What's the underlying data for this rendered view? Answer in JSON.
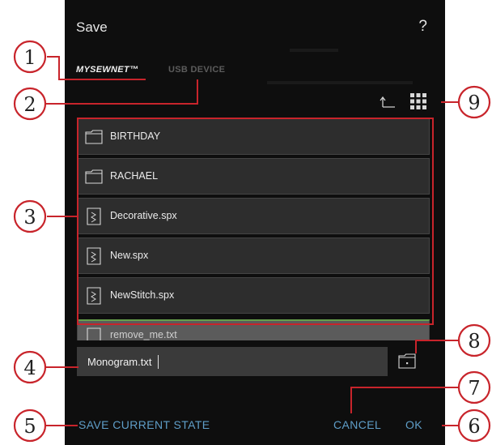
{
  "dialog": {
    "title": "Save",
    "help_label": "?",
    "tabs": [
      {
        "label": "MYSEWNET™",
        "active": true
      },
      {
        "label": "USB DEVICE",
        "active": false
      }
    ],
    "toolbar": {
      "up_icon": "folder-up-icon",
      "view_icon": "grid-view-icon"
    },
    "files": [
      {
        "name": "BIRTHDAY",
        "type": "folder",
        "icon": "folder-icon"
      },
      {
        "name": "RACHAEL",
        "type": "folder",
        "icon": "folder-icon"
      },
      {
        "name": "Decorative.spx",
        "type": "file",
        "icon": "stitch-file-icon"
      },
      {
        "name": "New.spx",
        "type": "file",
        "icon": "stitch-file-icon"
      },
      {
        "name": "NewStitch.spx",
        "type": "file",
        "icon": "stitch-file-icon"
      },
      {
        "name": "remove_me.txt",
        "type": "file",
        "icon": "stitch-file-icon"
      }
    ],
    "filename_input": {
      "value": "Monogram.txt"
    },
    "new_folder_icon": "new-folder-icon",
    "buttons": {
      "save_state": "SAVE CURRENT STATE",
      "cancel": "CANCEL",
      "ok": "OK"
    },
    "colors": {
      "background": "#0e0e0e",
      "row": "#2d2d2d",
      "accent": "#68a64a",
      "button_text": "#5f9ec8",
      "callout": "#c8242b"
    }
  },
  "callouts": {
    "c1": "1",
    "c2": "2",
    "c3": "3",
    "c4": "4",
    "c5": "5",
    "c6": "6",
    "c7": "7",
    "c8": "8",
    "c9": "9"
  }
}
